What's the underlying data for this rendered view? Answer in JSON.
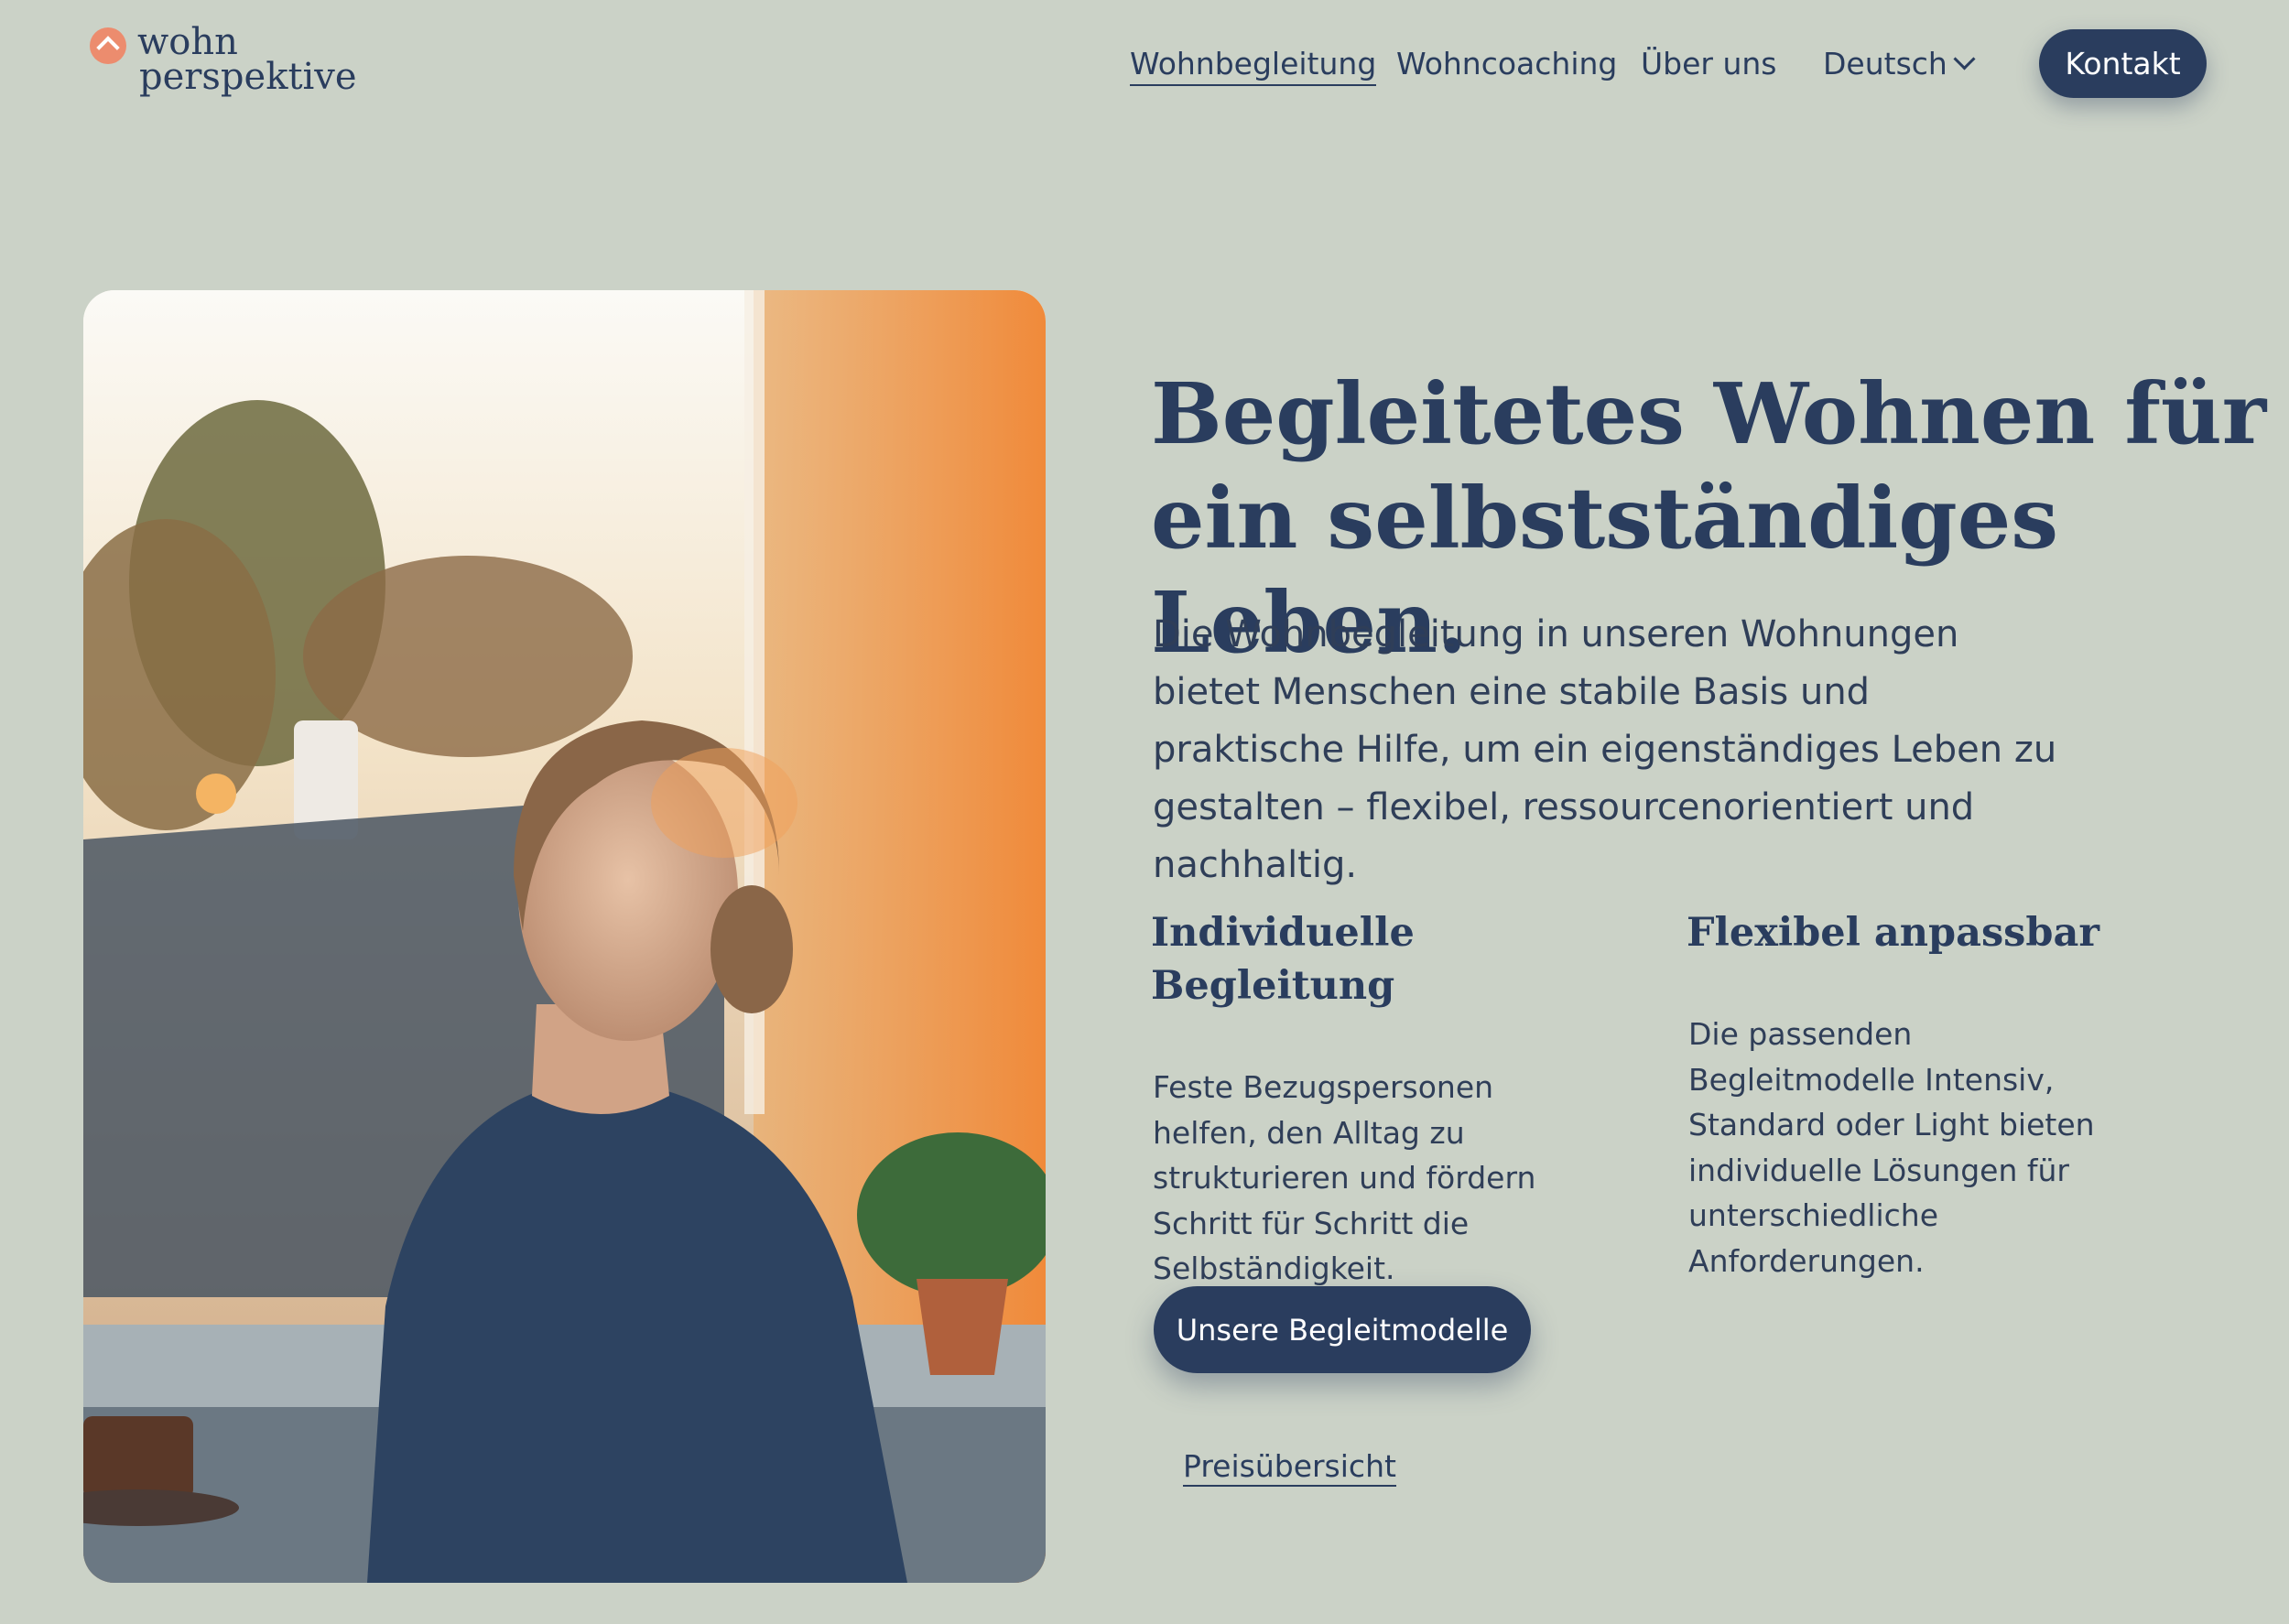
{
  "header": {
    "logo": {
      "line1": "wohn",
      "line2": "perspektive"
    },
    "nav": [
      {
        "label": "Wohnbegleitung",
        "active": true
      },
      {
        "label": "Wohncoaching",
        "active": false
      },
      {
        "label": "Über uns",
        "active": false
      }
    ],
    "language": "Deutsch",
    "contact_label": "Kontakt"
  },
  "hero": {
    "headline": "Begleitetes Wohnen für ein selbstständiges Leben.",
    "intro": "Die Wohnbegleitung in unseren Wohnungen bietet Menschen eine stabile Basis und praktische Hilfe, um ein eigenständiges Leben zu gestalten – flexibel, ressourcenorientiert und nachhaltig."
  },
  "features": [
    {
      "title": "Individuelle Begleitung",
      "text": "Feste Bezugspersonen helfen, den Alltag zu strukturieren und fördern Schritt für Schritt die Selbständigkeit."
    },
    {
      "title": "Flexibel anpassbar",
      "text": "Die passenden Begleitmodelle Intensiv, Standard oder Light bieten individuelle Lösungen für unterschiedliche Anforderungen."
    }
  ],
  "cta": {
    "primary_label": "Unsere Begleitmodelle",
    "secondary_label": "Preisübersicht"
  },
  "colors": {
    "background": "#cbd2c7",
    "navy": "#2a3d5e",
    "accent": "#ec8c6e"
  },
  "icons": [
    "logo-arc-icon",
    "chevron-down-icon"
  ]
}
